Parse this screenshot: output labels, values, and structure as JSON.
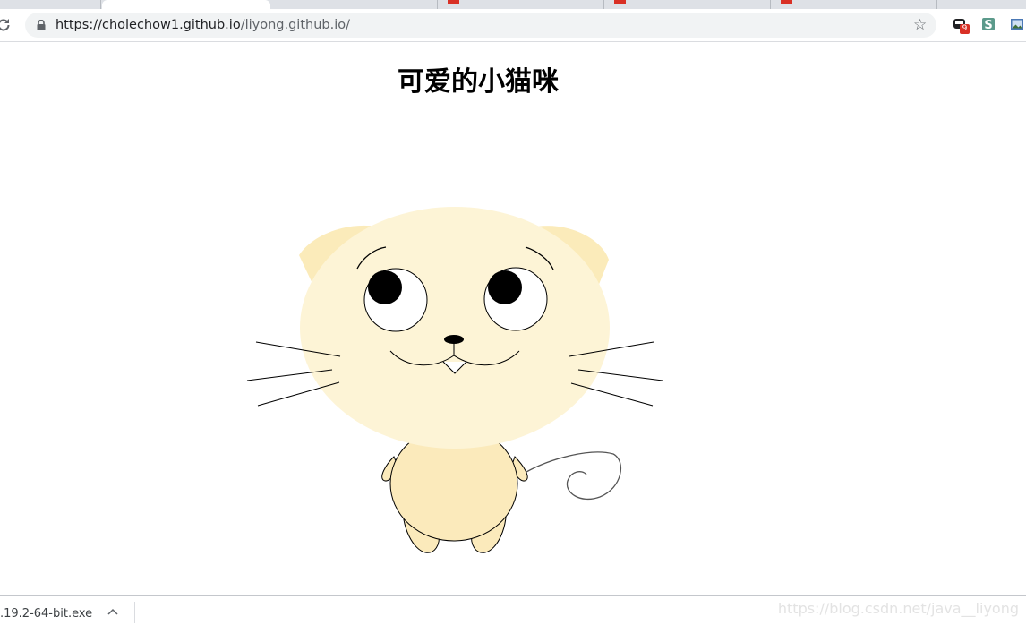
{
  "browser": {
    "address_bar": {
      "host": "https://cholechow1.github.io",
      "path": "/liyong.github.io/"
    },
    "extensions": [
      {
        "icon": "extension-badge-icon",
        "badge": "9"
      },
      {
        "icon": "s-extension-icon",
        "label": "S"
      },
      {
        "icon": "image-extension-icon"
      }
    ],
    "colors": {
      "tabstrip": "#dee1e6",
      "omnibox": "#f1f3f4",
      "badge": "#d93025"
    }
  },
  "page": {
    "title": "可爱的小猫咪",
    "cat_colors": {
      "head": "#fdf4d6",
      "ears": "#fbebba",
      "body": "#fbeabb",
      "eye_white": "#ffffff",
      "pupil": "#000000"
    }
  },
  "download_bar": {
    "file_name": ".19.2-64-bit.exe"
  },
  "watermark": "https://blog.csdn.net/java__liyong"
}
